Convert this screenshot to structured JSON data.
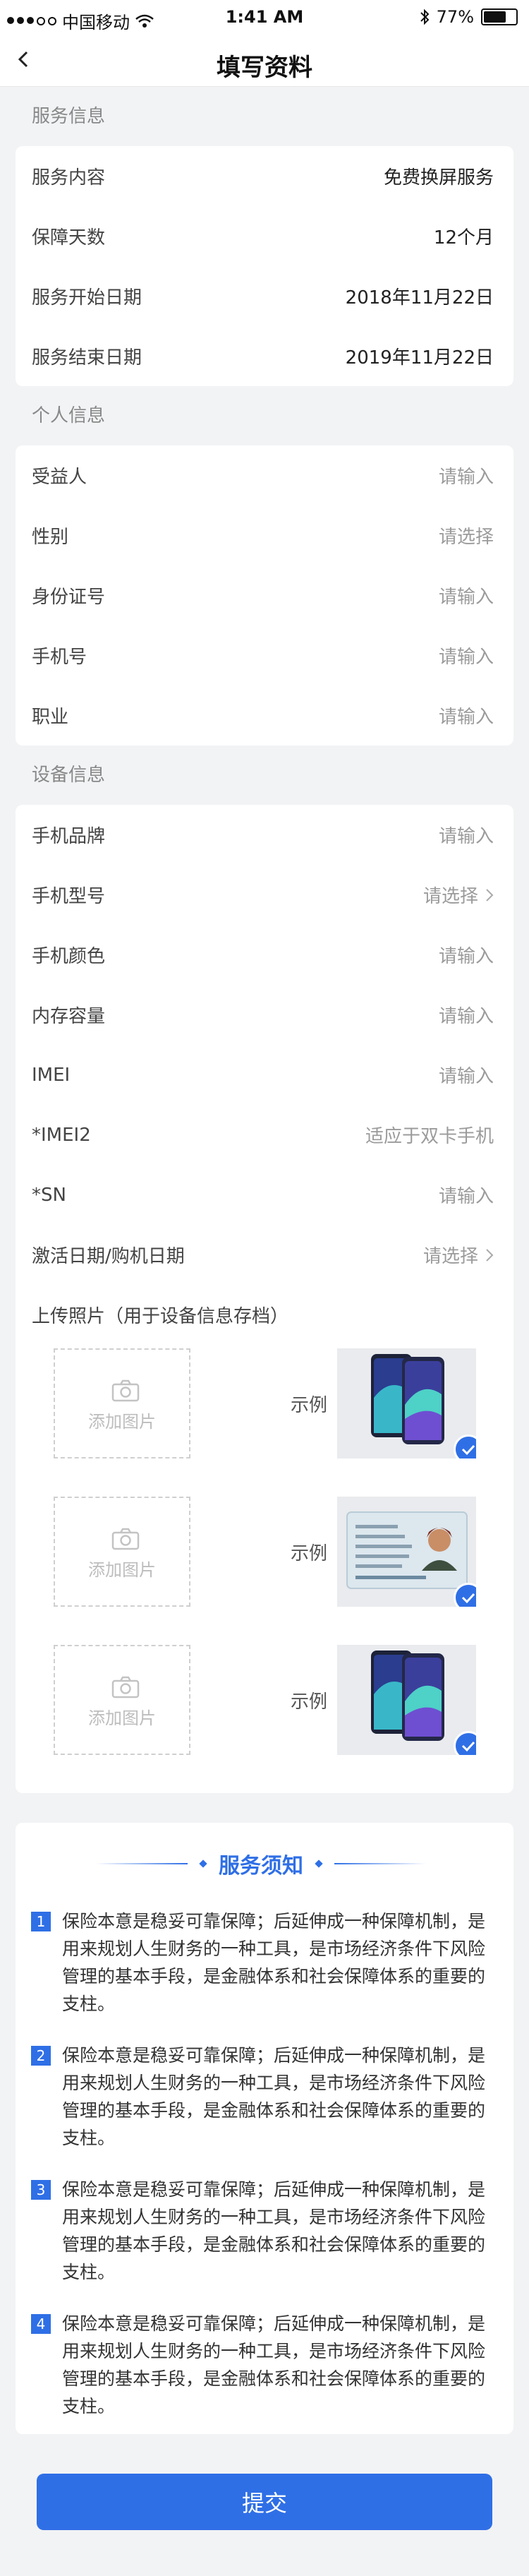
{
  "status": {
    "carrier": "中国移动",
    "time": "1:41 AM",
    "battery": "77%",
    "battery_level": 0.77
  },
  "header": {
    "title": "填写资料"
  },
  "service": {
    "title": "服务信息",
    "rows": [
      {
        "label": "服务内容",
        "value": "免费换屏服务"
      },
      {
        "label": "保障天数",
        "value": "12个月"
      },
      {
        "label": "服务开始日期",
        "value": "2018年11月22日"
      },
      {
        "label": "服务结束日期",
        "value": "2019年11月22日"
      }
    ]
  },
  "personal": {
    "title": "个人信息",
    "rows": [
      {
        "label": "受益人",
        "placeholder": "请输入"
      },
      {
        "label": "性别",
        "placeholder": "请选择"
      },
      {
        "label": "身份证号",
        "placeholder": "请输入"
      },
      {
        "label": "手机号",
        "placeholder": "请输入"
      },
      {
        "label": "职业",
        "placeholder": "请输入"
      }
    ]
  },
  "device": {
    "title": "设备信息",
    "rows": [
      {
        "label": "手机品牌",
        "placeholder": "请输入"
      },
      {
        "label": "手机型号",
        "placeholder": "请选择"
      },
      {
        "label": "手机颜色",
        "placeholder": "请输入"
      },
      {
        "label": "内存容量",
        "placeholder": "请输入"
      },
      {
        "label": "IMEI",
        "placeholder": "请输入"
      },
      {
        "label": "*IMEI2",
        "placeholder": "适应于双卡手机"
      },
      {
        "label": "*SN",
        "placeholder": "请输入"
      },
      {
        "label": "激活日期/购机日期",
        "placeholder": "请选择"
      }
    ],
    "upload_title": "上传照片（用于设备信息存档）",
    "add_photo_label": "添加图片",
    "example_label": "示例"
  },
  "notice": {
    "title": "服务须知",
    "items": [
      {
        "num": "1",
        "text": "保险本意是稳妥可靠保障；后延伸成一种保障机制，是用来规划人生财务的一种工具，是市场经济条件下风险管理的基本手段，是金融体系和社会保障体系的重要的支柱。"
      },
      {
        "num": "2",
        "text": "保险本意是稳妥可靠保障；后延伸成一种保障机制，是用来规划人生财务的一种工具，是市场经济条件下风险管理的基本手段，是金融体系和社会保障体系的重要的支柱。"
      },
      {
        "num": "3",
        "text": "保险本意是稳妥可靠保障；后延伸成一种保障机制，是用来规划人生财务的一种工具，是市场经济条件下风险管理的基本手段，是金融体系和社会保障体系的重要的支柱。"
      },
      {
        "num": "4",
        "text": "保险本意是稳妥可靠保障；后延伸成一种保障机制，是用来规划人生财务的一种工具，是市场经济条件下风险管理的基本手段，是金融体系和社会保障体系的重要的支柱。"
      }
    ]
  },
  "submit_label": "提交",
  "colors": {
    "accent": "#2f6fe6",
    "background": "#f2f3f5"
  }
}
